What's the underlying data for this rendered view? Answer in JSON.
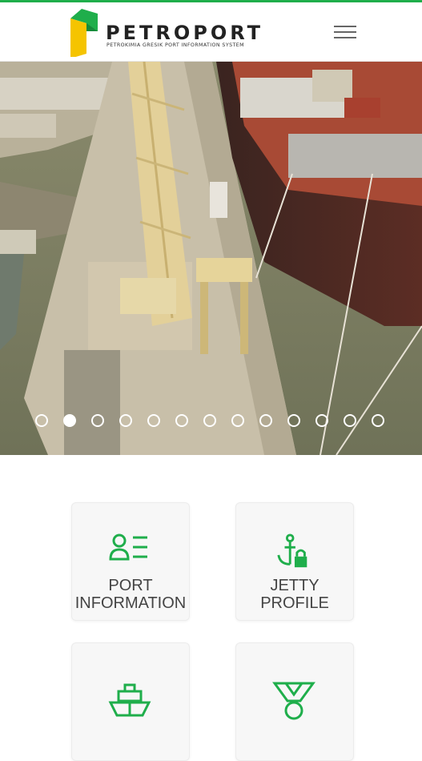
{
  "brand": {
    "title": "PETROPORT",
    "subtitle": "PETROKIMIA GRESIK PORT INFORMATION SYSTEM",
    "accent": "#1fae4b",
    "accent_yellow": "#f5c400"
  },
  "header": {
    "menu_icon": "hamburger-menu-icon"
  },
  "carousel": {
    "slide_count": 13,
    "active_index": 1
  },
  "tiles": [
    {
      "label": "PORT\nINFORMATION",
      "icon": "person-list-icon"
    },
    {
      "label": "JETTY\nPROFILE",
      "icon": "anchor-lock-icon"
    },
    {
      "label": "",
      "icon": "ship-icon"
    },
    {
      "label": "",
      "icon": "medal-icon"
    }
  ]
}
